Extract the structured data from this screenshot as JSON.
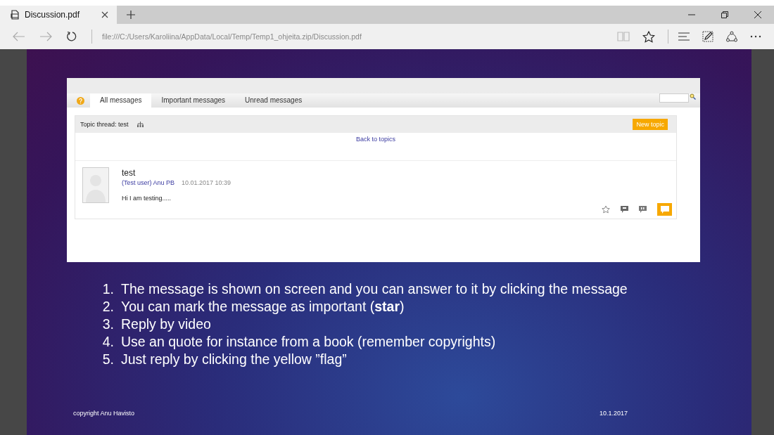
{
  "browser": {
    "tab": {
      "title": "Discussion.pdf",
      "selected": true
    },
    "address": "file:///C:/Users/Karoliina/AppData/Local/Temp/Temp1_ohjeita.zip/Discussion.pdf"
  },
  "slide": {
    "forum": {
      "tabs": [
        {
          "label": "All messages",
          "selected": true
        },
        {
          "label": "Important messages",
          "selected": false
        },
        {
          "label": "Unread messages",
          "selected": false
        }
      ],
      "topic_thread": "Topic thread: test",
      "new_topic_button": "New topic",
      "back_link": "Back to topics",
      "message": {
        "title": "test",
        "author": "(Test user) Anu PB",
        "timestamp": "10.01.2017 10:39",
        "body": "Hi I am testing....."
      }
    },
    "steps": [
      {
        "number": "1.",
        "text": "The message is shown on screen and you can answer to it by clicking the message"
      },
      {
        "number": "2.",
        "text": "You can mark the message as important (**star**)"
      },
      {
        "number": "3.",
        "text": "Reply by video"
      },
      {
        "number": "4.",
        "text": "Use an quote for instance from a book (remember copyrights)"
      },
      {
        "number": "5.",
        "text": "Just reply by clicking the yellow ”flag”"
      }
    ],
    "footer": {
      "copyright": "copyright Anu Havisto",
      "date": "10.1.2017"
    }
  }
}
